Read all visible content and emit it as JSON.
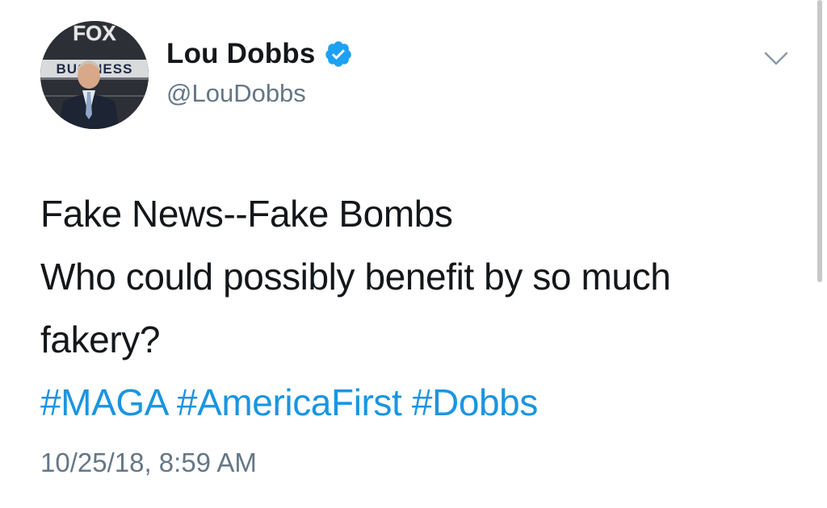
{
  "tweet": {
    "avatar": {
      "logo_top": "FOX",
      "logo_band": "BUSINESS"
    },
    "author": {
      "display_name": "Lou Dobbs",
      "handle": "@LouDobbs",
      "verified": true
    },
    "text_lines": [
      "Fake News--Fake Bombs",
      "Who could possibly benefit by so much",
      "fakery?"
    ],
    "hashtags": [
      "#MAGA",
      "#AmericaFirst",
      "#Dobbs"
    ],
    "timestamp": "10/25/18, 8:59 AM"
  },
  "icons": {
    "verified": "verified-badge-icon",
    "menu": "chevron-down-icon"
  },
  "colors": {
    "text": "#14171a",
    "secondary": "#657786",
    "link": "#1b95e0",
    "verified": "#1da1f2"
  }
}
